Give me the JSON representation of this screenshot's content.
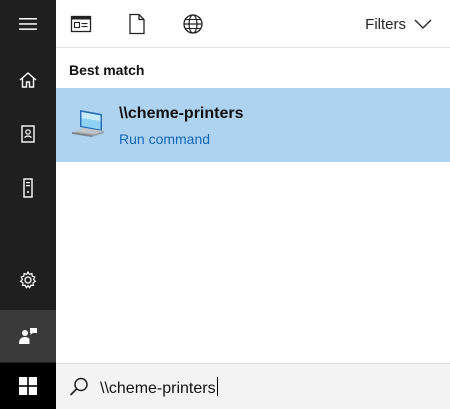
{
  "rail": {
    "items": [
      {
        "icon": "hamburger-menu-icon"
      },
      {
        "icon": "home-icon"
      },
      {
        "icon": "notebook-icon"
      },
      {
        "icon": "tower-pc-icon"
      },
      {
        "icon": "gear-icon"
      },
      {
        "icon": "feedback-icon"
      }
    ],
    "start_icon": "windows-logo-icon"
  },
  "topbar": {
    "filters_label": "Filters",
    "icons": [
      "apps-icon",
      "documents-icon",
      "web-icon"
    ]
  },
  "results": {
    "section_label": "Best match",
    "best_match": {
      "title": "\\\\cheme-printers",
      "subtitle": "Run command",
      "icon": "computer-network-icon"
    }
  },
  "search": {
    "value": "\\\\cheme-printers"
  },
  "colors": {
    "rail_bg": "#1f1f1f",
    "selection_bg": "#aed3f1",
    "link": "#1467b8"
  }
}
